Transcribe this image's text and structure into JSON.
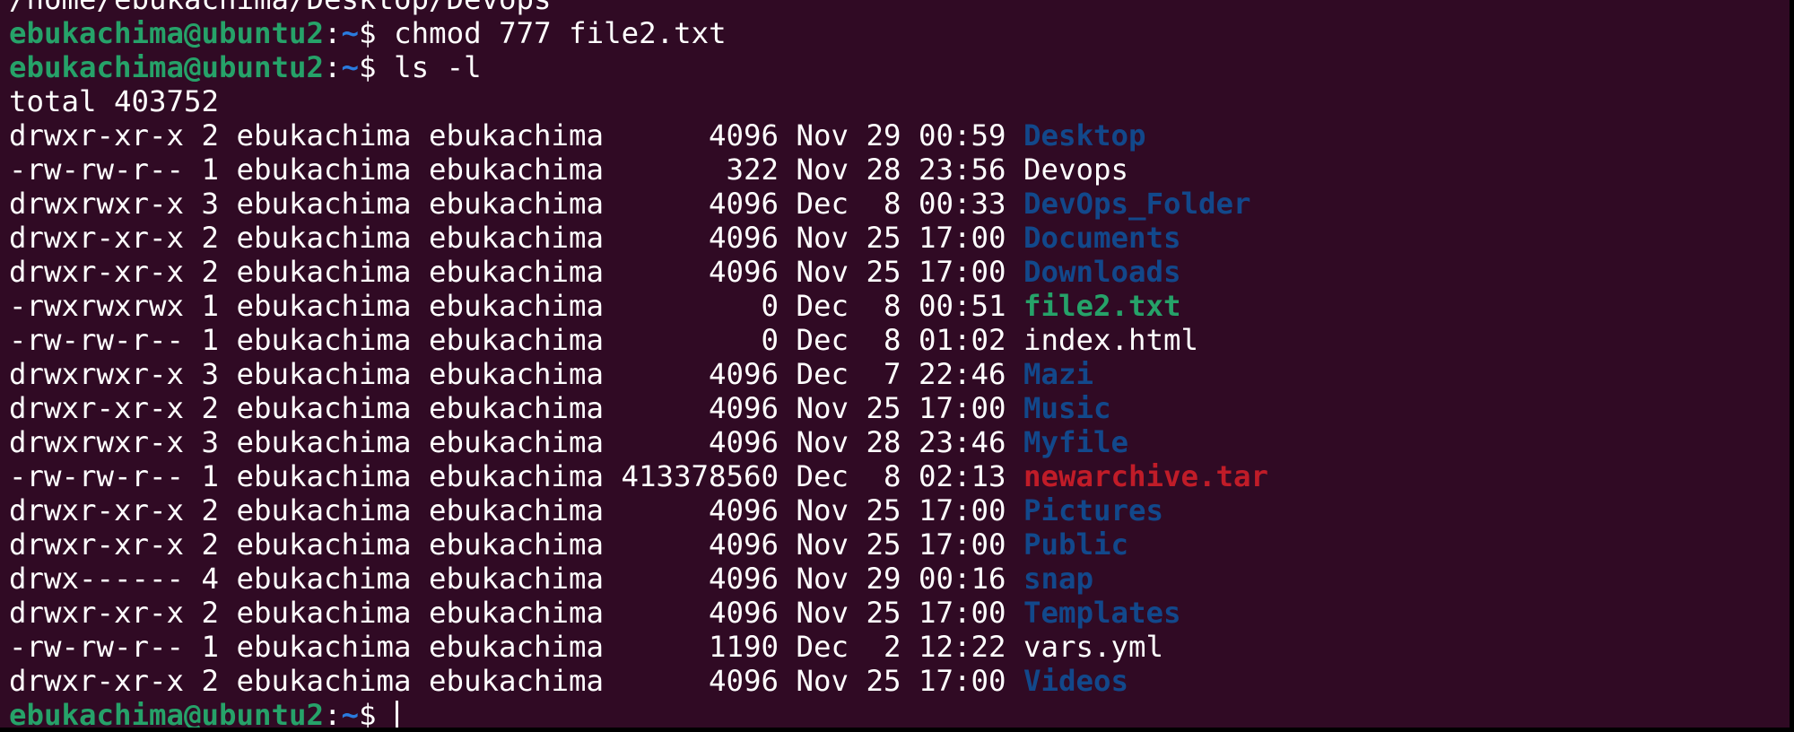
{
  "terminal": {
    "colors": {
      "background": "#300a24",
      "foreground": "#ffffff",
      "user": "#26a269",
      "path": "#2a7bde",
      "directory": "#12488b",
      "executable": "#26a269",
      "archive": "#c01c28"
    },
    "prev_output": "/home/ebukachima/Desktop/Devops",
    "prompt": {
      "user_host": "ebukachima@ubuntu2",
      "separator": ":",
      "path": "~",
      "symbol": "$ "
    },
    "commands": [
      "chmod 777 file2.txt",
      "ls -l"
    ],
    "total_line": "total 403752",
    "listing": [
      {
        "meta": "drwxr-xr-x 2 ebukachima ebukachima      4096 Nov 29 00:59 ",
        "name": "Desktop",
        "type": "dir"
      },
      {
        "meta": "-rw-rw-r-- 1 ebukachima ebukachima       322 Nov 28 23:56 ",
        "name": "Devops",
        "type": "plain"
      },
      {
        "meta": "drwxrwxr-x 3 ebukachima ebukachima      4096 Dec  8 00:33 ",
        "name": "DevOps_Folder",
        "type": "dir"
      },
      {
        "meta": "drwxr-xr-x 2 ebukachima ebukachima      4096 Nov 25 17:00 ",
        "name": "Documents",
        "type": "dir"
      },
      {
        "meta": "drwxr-xr-x 2 ebukachima ebukachima      4096 Nov 25 17:00 ",
        "name": "Downloads",
        "type": "dir"
      },
      {
        "meta": "-rwxrwxrwx 1 ebukachima ebukachima         0 Dec  8 00:51 ",
        "name": "file2.txt",
        "type": "exec"
      },
      {
        "meta": "-rw-rw-r-- 1 ebukachima ebukachima         0 Dec  8 01:02 ",
        "name": "index.html",
        "type": "plain"
      },
      {
        "meta": "drwxrwxr-x 3 ebukachima ebukachima      4096 Dec  7 22:46 ",
        "name": "Mazi",
        "type": "dir"
      },
      {
        "meta": "drwxr-xr-x 2 ebukachima ebukachima      4096 Nov 25 17:00 ",
        "name": "Music",
        "type": "dir"
      },
      {
        "meta": "drwxrwxr-x 3 ebukachima ebukachima      4096 Nov 28 23:46 ",
        "name": "Myfile",
        "type": "dir"
      },
      {
        "meta": "-rw-rw-r-- 1 ebukachima ebukachima 413378560 Dec  8 02:13 ",
        "name": "newarchive.tar",
        "type": "archive"
      },
      {
        "meta": "drwxr-xr-x 2 ebukachima ebukachima      4096 Nov 25 17:00 ",
        "name": "Pictures",
        "type": "dir"
      },
      {
        "meta": "drwxr-xr-x 2 ebukachima ebukachima      4096 Nov 25 17:00 ",
        "name": "Public",
        "type": "dir"
      },
      {
        "meta": "drwx------ 4 ebukachima ebukachima      4096 Nov 29 00:16 ",
        "name": "snap",
        "type": "dir"
      },
      {
        "meta": "drwxr-xr-x 2 ebukachima ebukachima      4096 Nov 25 17:00 ",
        "name": "Templates",
        "type": "dir"
      },
      {
        "meta": "-rw-rw-r-- 1 ebukachima ebukachima      1190 Dec  2 12:22 ",
        "name": "vars.yml",
        "type": "plain"
      },
      {
        "meta": "drwxr-xr-x 2 ebukachima ebukachima      4096 Nov 25 17:00 ",
        "name": "Videos",
        "type": "dir"
      }
    ]
  }
}
